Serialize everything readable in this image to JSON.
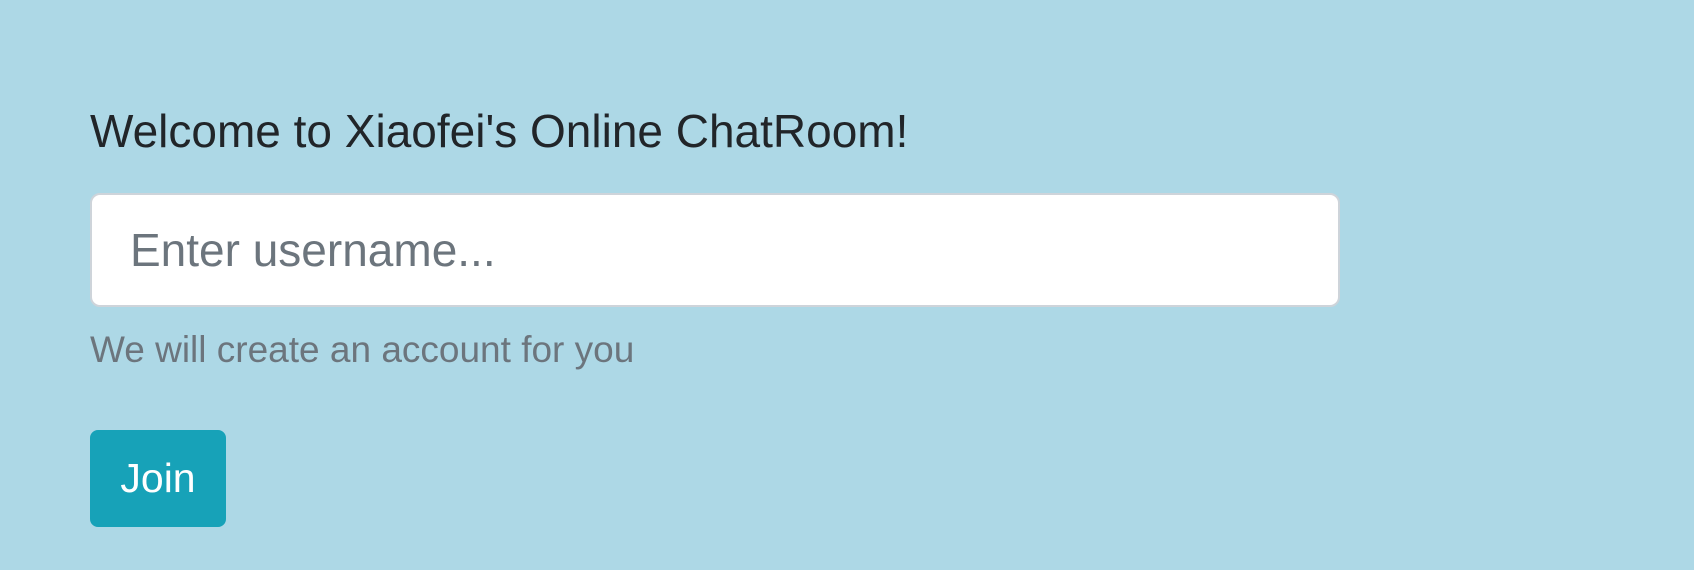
{
  "login": {
    "title": "Welcome to Xiaofei's Online ChatRoom!",
    "username": {
      "value": "",
      "placeholder": "Enter username..."
    },
    "help_text": "We will create an account for you",
    "join_label": "Join"
  },
  "colors": {
    "background": "#add8e6",
    "button": "#17a2b8",
    "muted_text": "#6c757d"
  }
}
